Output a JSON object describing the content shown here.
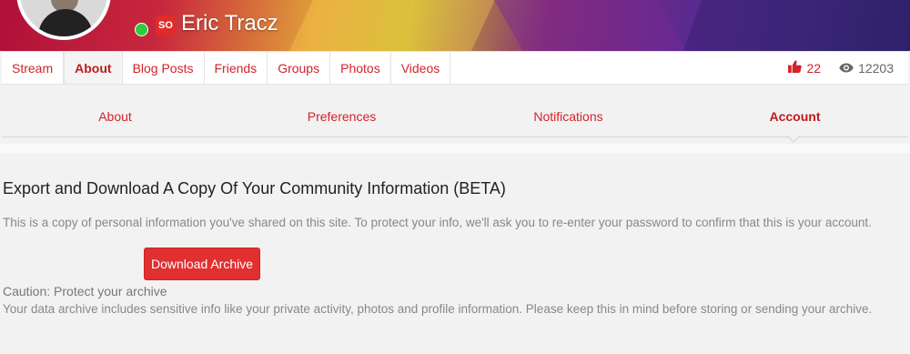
{
  "profile": {
    "name": "Eric Tracz",
    "badge": "SO",
    "online": true
  },
  "profile_nav": {
    "items": [
      {
        "label": "Stream"
      },
      {
        "label": "About",
        "active": true
      },
      {
        "label": "Blog Posts"
      },
      {
        "label": "Friends"
      },
      {
        "label": "Groups"
      },
      {
        "label": "Photos"
      },
      {
        "label": "Videos"
      }
    ],
    "likes": "22",
    "views": "12203"
  },
  "subtabs": {
    "items": [
      {
        "label": "About"
      },
      {
        "label": "Preferences"
      },
      {
        "label": "Notifications"
      },
      {
        "label": "Account",
        "active": true
      }
    ]
  },
  "export": {
    "title": "Export and Download A Copy Of Your Community Information (BETA)",
    "description": "This is a copy of personal information you've shared on this site. To protect your info, we'll ask you to re-enter your password to confirm that this is your account.",
    "button_label": "Download Archive",
    "caution_title": "Caution: Protect your archive",
    "caution_text": "Your data archive includes sensitive info like your private activity, photos and profile information. Please keep this in mind before storing or sending your archive."
  },
  "colors": {
    "accent": "#d2232a",
    "button": "#e23030",
    "online": "#2ecc40"
  }
}
